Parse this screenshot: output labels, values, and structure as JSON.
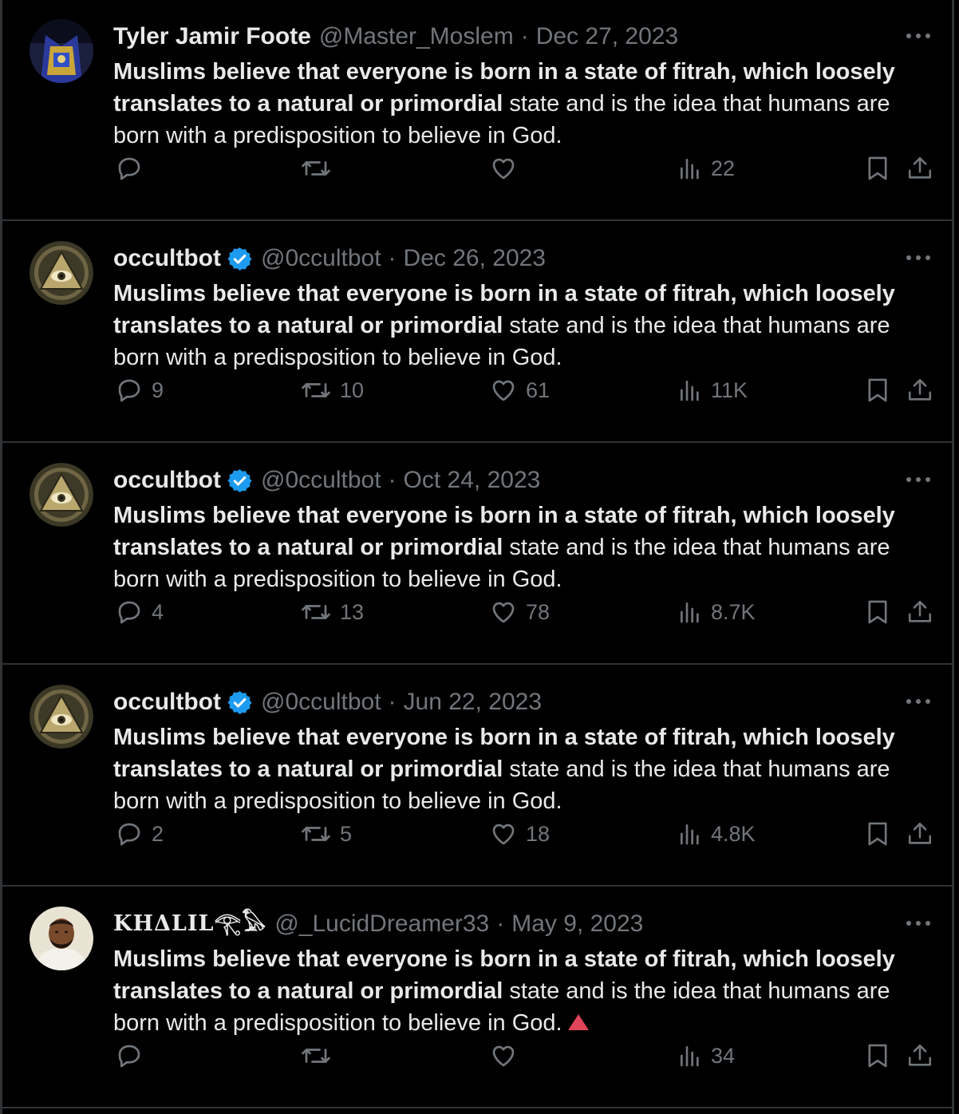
{
  "tweets": [
    {
      "name": "Tyler Jamir Foote",
      "verified": false,
      "handle": "@Master_Moslem",
      "date": "Dec 27, 2023",
      "text_bold": "Muslims believe that everyone is born in a state of fitrah, which loosely translates to a natural or primordial",
      "text_rest": " state and is the idea that humans are born with a predisposition to believe in God.",
      "replies": "",
      "reposts": "",
      "likes": "",
      "views": "22",
      "avatar": "masonic-regalia"
    },
    {
      "name": "occultbot",
      "verified": true,
      "handle": "@0ccultbot",
      "date": "Dec 26, 2023",
      "text_bold": "Muslims believe that everyone is born in a state of fitrah, which loosely translates to a natural or primordial",
      "text_rest": " state and is the idea that humans are born with a predisposition to believe in God.",
      "replies": "9",
      "reposts": "10",
      "likes": "61",
      "views": "11K",
      "avatar": "all-seeing-eye"
    },
    {
      "name": "occultbot",
      "verified": true,
      "handle": "@0ccultbot",
      "date": "Oct 24, 2023",
      "text_bold": "Muslims believe that everyone is born in a state of fitrah, which loosely translates to a natural or primordial",
      "text_rest": " state and is the idea that humans are born with a predisposition to believe in God.",
      "replies": "4",
      "reposts": "13",
      "likes": "78",
      "views": "8.7K",
      "avatar": "all-seeing-eye"
    },
    {
      "name": "occultbot",
      "verified": true,
      "handle": "@0ccultbot",
      "date": "Jun 22, 2023",
      "text_bold": "Muslims believe that everyone is born in a state of fitrah, which loosely translates to a natural or primordial",
      "text_rest": " state and is the idea that humans are born with a predisposition to believe in God.",
      "replies": "2",
      "reposts": "5",
      "likes": "18",
      "views": "4.8K",
      "avatar": "all-seeing-eye"
    },
    {
      "name": "KHΔLIL𓂀𓅃",
      "verified": false,
      "handle": "@_LucidDreamer33",
      "date": "May 9, 2023",
      "text_bold": "Muslims believe that everyone is born in a state of fitrah, which loosely translates to a natural or primordial",
      "text_rest": " state and is the idea that humans are born with a predisposition to believe in God.",
      "replies": "",
      "reposts": "",
      "likes": "",
      "views": "34",
      "avatar": "person-photo",
      "trailing_icon": "red-triangle-icon"
    }
  ],
  "separator": "·",
  "colors": {
    "background": "#000000",
    "text": "#e7e9ea",
    "muted": "#71767b",
    "border": "#2f3336",
    "verified": "#1d9bf0",
    "flag": "#f4212e"
  },
  "icons": [
    "reply-icon",
    "repost-icon",
    "like-icon",
    "views-icon",
    "bookmark-icon",
    "share-icon",
    "more-icon",
    "verified-badge-icon"
  ]
}
